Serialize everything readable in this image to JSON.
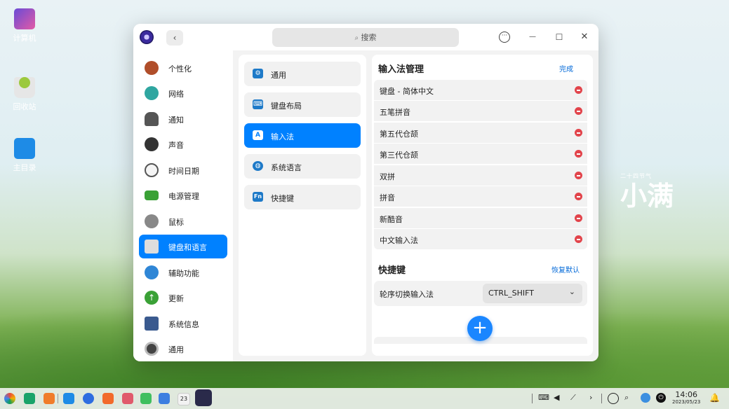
{
  "desktop": {
    "icons": [
      {
        "label": "计算机",
        "icon": "computer-icon"
      },
      {
        "label": "回收站",
        "icon": "trash-icon"
      },
      {
        "label": "主目录",
        "icon": "home-folder-icon"
      }
    ],
    "solar_term_small": "二十四节气",
    "solar_term": "小满"
  },
  "window": {
    "search_placeholder": "搜索",
    "back_label": "‹",
    "menu_icon": "more-icon",
    "minimize_label": "—",
    "maximize_label": "☐",
    "close_label": "✕"
  },
  "sidebar": {
    "items": [
      {
        "label": "个性化",
        "icon": "personalization-icon",
        "color": "#b04e2a"
      },
      {
        "label": "网络",
        "icon": "network-icon",
        "color": "#2fa6a0"
      },
      {
        "label": "通知",
        "icon": "notification-icon",
        "color": "#555555"
      },
      {
        "label": "声音",
        "icon": "sound-icon",
        "color": "#333333"
      },
      {
        "label": "时间日期",
        "icon": "clock-icon",
        "color": "#d9d9d9"
      },
      {
        "label": "电源管理",
        "icon": "battery-icon",
        "color": "#3aa136"
      },
      {
        "label": "鼠标",
        "icon": "mouse-icon",
        "color": "#777777"
      },
      {
        "label": "键盘和语言",
        "icon": "keyboard-icon",
        "color": "#666666",
        "active": true
      },
      {
        "label": "辅助功能",
        "icon": "accessibility-icon",
        "color": "#2f86d6"
      },
      {
        "label": "更新",
        "icon": "update-icon",
        "color": "#3aa136"
      },
      {
        "label": "系统信息",
        "icon": "system-info-icon",
        "color": "#3a5a8f"
      },
      {
        "label": "通用",
        "icon": "general-icon",
        "color": "#444444"
      }
    ]
  },
  "submenu": {
    "items": [
      {
        "label": "通用",
        "icon": "gear-icon",
        "glyph": "⚙"
      },
      {
        "label": "键盘布局",
        "icon": "keyboard-layout-icon",
        "glyph": "⌨"
      },
      {
        "label": "输入法",
        "icon": "input-method-icon",
        "glyph": "A",
        "active": true
      },
      {
        "label": "系统语言",
        "icon": "globe-icon",
        "glyph": "◍"
      },
      {
        "label": "快捷键",
        "icon": "shortcut-icon",
        "glyph": "Fn"
      }
    ]
  },
  "input_methods": {
    "title": "输入法管理",
    "done_label": "完成",
    "items": [
      "键盘 - 简体中文",
      "五笔拼音",
      "第五代仓颉",
      "第三代仓颉",
      "双拼",
      "拼音",
      "新酷音",
      "中文输入法"
    ]
  },
  "shortcuts": {
    "title": "快捷键",
    "reset_label": "恢复默认",
    "switch_label": "轮序切换输入法",
    "switch_value": "CTRL_SHIFT",
    "add_label": "+"
  },
  "taskbar": {
    "time": "14:06",
    "date": "2023/05/23",
    "calendar_day": "23",
    "colors": {
      "accent": "#0081ff"
    }
  }
}
